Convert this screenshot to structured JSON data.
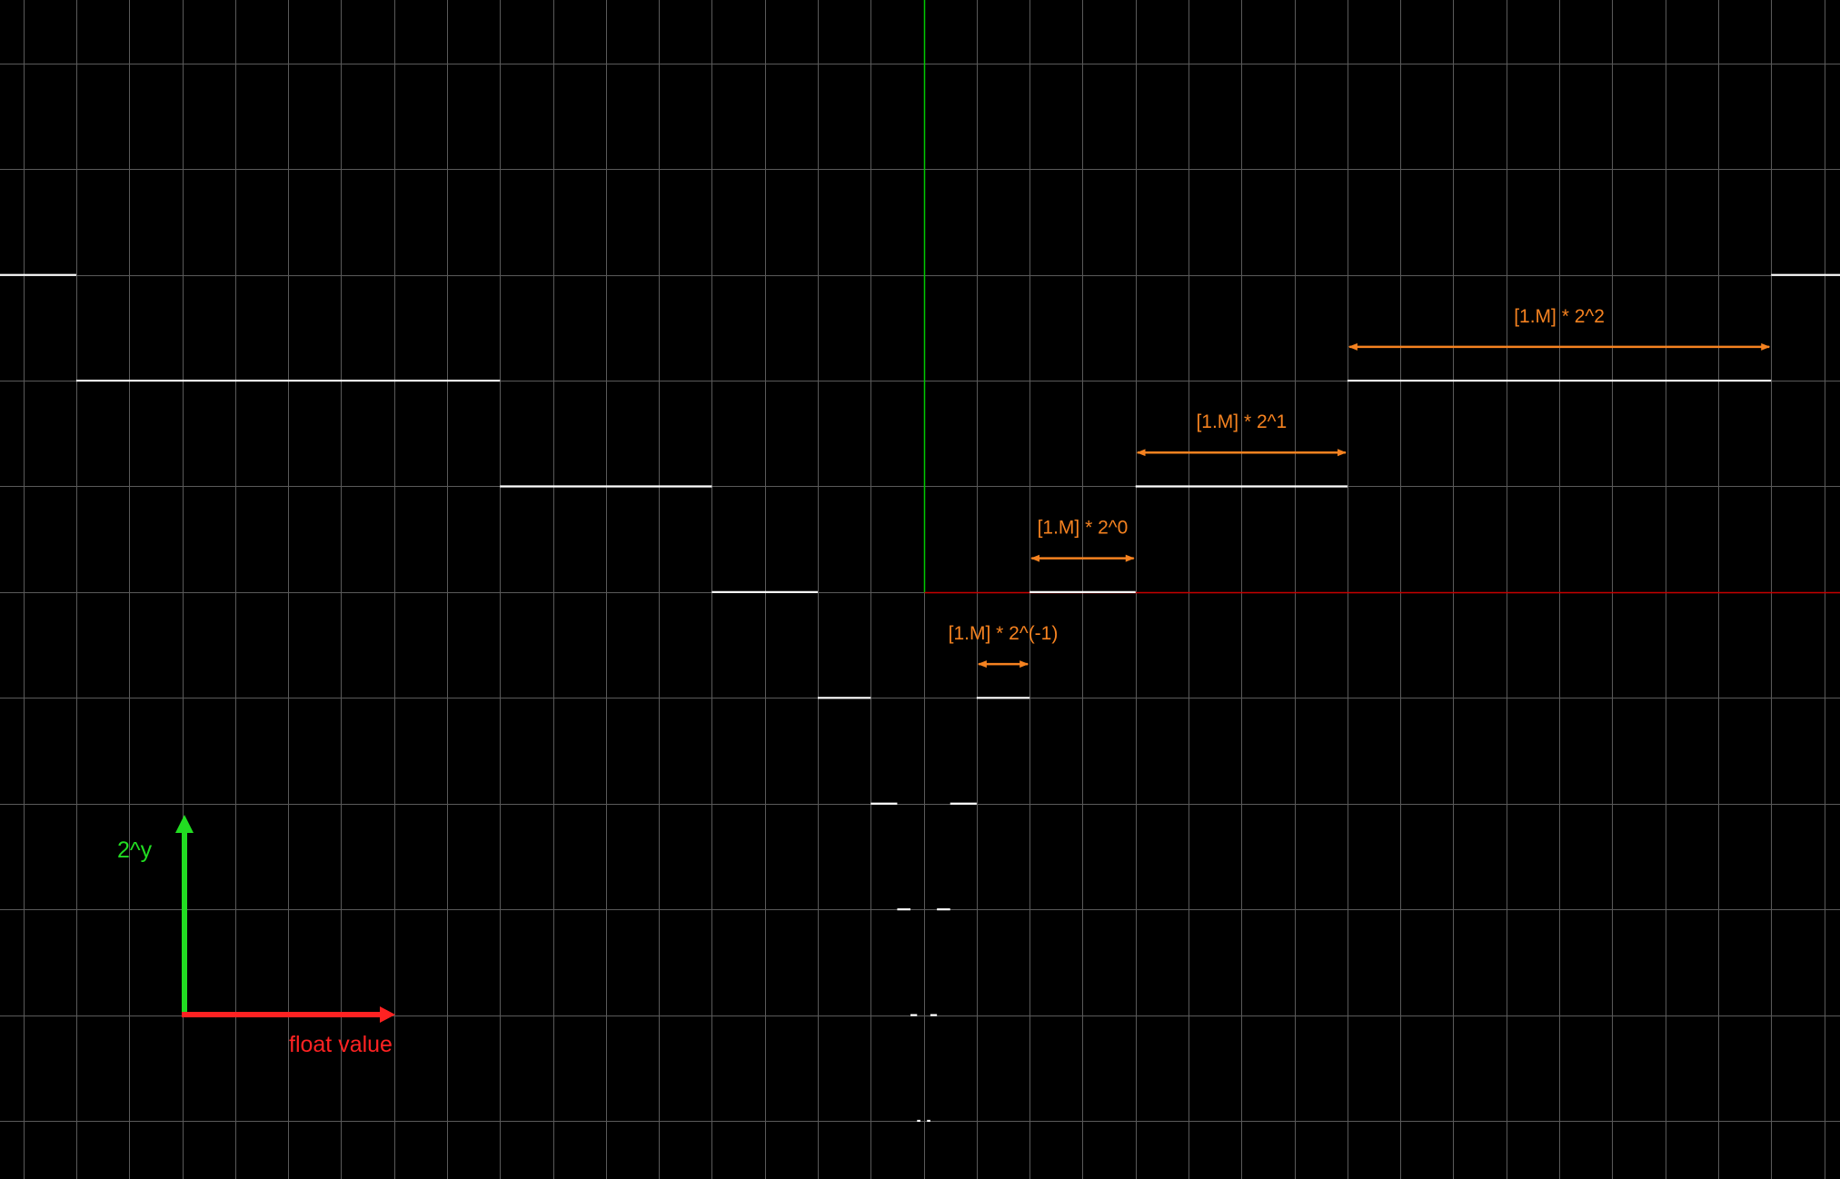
{
  "colors": {
    "background": "#000000",
    "grid": "#5a5a5a",
    "steps": "#ffffff",
    "y_axis": "#00c800",
    "x_axis": "#c80000",
    "annotation": "#f58220",
    "legend_y": "#22dd22",
    "legend_x": "#ff2222"
  },
  "legend": {
    "y_label": "2^y",
    "x_label": "float value"
  },
  "chart_data": {
    "type": "step",
    "description_units": "x = float value, y = exponent (level height 2^y)",
    "grid_spacing_x": 0.5,
    "xlim": [
      -8.72,
      8.65
    ],
    "ylim": [
      -5.55,
      5.6
    ],
    "levels": [
      {
        "exponent": 3,
        "ranges": [
          [
            -9,
            -8
          ],
          [
            8,
            9
          ]
        ]
      },
      {
        "exponent": 2,
        "ranges": [
          [
            -8,
            -4
          ],
          [
            4,
            8
          ]
        ]
      },
      {
        "exponent": 1,
        "ranges": [
          [
            -4,
            -2
          ],
          [
            2,
            4
          ]
        ]
      },
      {
        "exponent": 0,
        "ranges": [
          [
            -2,
            -1
          ],
          [
            1,
            2
          ]
        ]
      },
      {
        "exponent": -1,
        "ranges": [
          [
            -1,
            -0.5
          ],
          [
            0.5,
            1
          ]
        ]
      },
      {
        "exponent": -2,
        "ranges": [
          [
            -0.5,
            -0.25
          ],
          [
            0.25,
            0.5
          ]
        ]
      },
      {
        "exponent": -3,
        "ranges": [
          [
            -0.25,
            -0.125
          ],
          [
            0.125,
            0.25
          ]
        ]
      },
      {
        "exponent": -4,
        "ranges": [
          [
            -0.125,
            -0.0625
          ],
          [
            0.0625,
            0.125
          ]
        ]
      },
      {
        "exponent": -5,
        "ranges": [
          [
            -0.0625,
            -0.03125
          ],
          [
            0.03125,
            0.0625
          ]
        ]
      }
    ],
    "annotations": [
      {
        "label": "[1.M] * 2^2",
        "from": 4,
        "to": 8,
        "exponent": 2
      },
      {
        "label": "[1.M] * 2^1",
        "from": 2,
        "to": 4,
        "exponent": 1
      },
      {
        "label": "[1.M] * 2^0",
        "from": 1,
        "to": 2,
        "exponent": 0
      },
      {
        "label": "[1.M] * 2^(-1)",
        "from": 0.5,
        "to": 1,
        "exponent": -1
      }
    ]
  }
}
